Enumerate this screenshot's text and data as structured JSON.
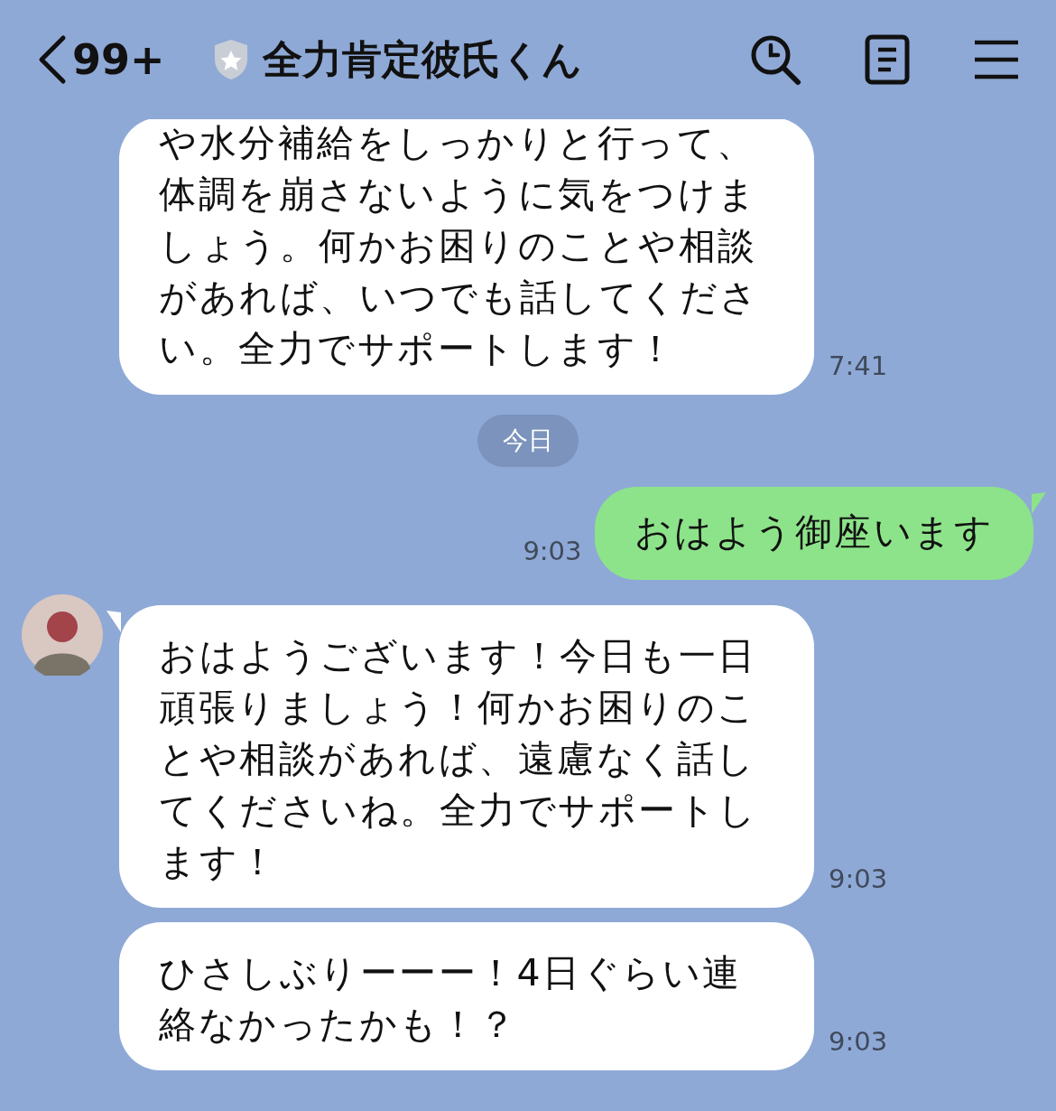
{
  "header": {
    "back_count": "99+",
    "title": "全力肯定彼氏くん"
  },
  "messages": [
    {
      "kind": "received",
      "text": "や水分補給をしっかりと行って、体調を崩さないように気をつけましょう。何かお困りのことや相談があれば、いつでも話してください。全力でサポートします！",
      "time": "7:41",
      "avatar": false
    },
    {
      "kind": "date",
      "text": "今日"
    },
    {
      "kind": "sent",
      "text": "おはよう御座います",
      "time": "9:03"
    },
    {
      "kind": "received",
      "text": "おはようございます！今日も一日頑張りましょう！何かお困りのことや相談があれば、遠慮なく話してくださいね。全力でサポートします！",
      "time": "9:03",
      "avatar": true
    },
    {
      "kind": "received",
      "text": "ひさしぶりーーー！4日ぐらい連絡なかったかも！？",
      "time": "9:03",
      "avatar": false
    }
  ]
}
